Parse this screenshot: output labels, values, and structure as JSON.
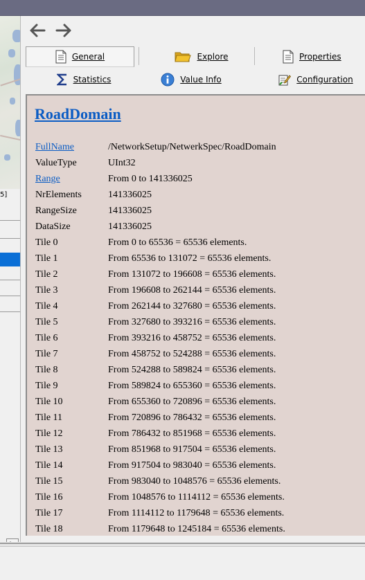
{
  "left_panel": {
    "tag_text": "5]"
  },
  "toolbar": {
    "general": "General",
    "explore": "Explore",
    "properties": "Properties",
    "statistics": "Statistics",
    "value_info": "Value Info",
    "configuration": "Configuration"
  },
  "icons": {
    "back": "arrow-left-icon",
    "forward": "arrow-right-icon",
    "general": "document-icon",
    "explore": "folder-icon",
    "properties": "document-icon",
    "statistics": "sigma-icon",
    "value_info": "info-icon",
    "configuration": "edit-document-icon"
  },
  "colors": {
    "link": "#0b5cc4",
    "content_bg": "#e1d4d0",
    "title_bar": "#6a6b82",
    "info_blue": "#3a7fd4",
    "folder_yellow": "#f2c22e"
  },
  "page": {
    "title": "RoadDomain",
    "rows": [
      {
        "key": "FullName",
        "value": "/NetworkSetup/NetwerkSpec/RoadDomain",
        "link": true
      },
      {
        "key": "ValueType",
        "value": "UInt32",
        "link": false
      },
      {
        "key": "Range",
        "value": "From 0 to 141336025",
        "link": true
      },
      {
        "key": "NrElements",
        "value": "141336025",
        "link": false
      },
      {
        "key": "RangeSize",
        "value": "141336025",
        "link": false
      },
      {
        "key": "DataSize",
        "value": "141336025",
        "link": false
      },
      {
        "key": "Tile 0",
        "value": "From 0 to 65536 = 65536 elements.",
        "link": false
      },
      {
        "key": "Tile 1",
        "value": "From 65536 to 131072 = 65536 elements.",
        "link": false
      },
      {
        "key": "Tile 2",
        "value": "From 131072 to 196608 = 65536 elements.",
        "link": false
      },
      {
        "key": "Tile 3",
        "value": "From 196608 to 262144 = 65536 elements.",
        "link": false
      },
      {
        "key": "Tile 4",
        "value": "From 262144 to 327680 = 65536 elements.",
        "link": false
      },
      {
        "key": "Tile 5",
        "value": "From 327680 to 393216 = 65536 elements.",
        "link": false
      },
      {
        "key": "Tile 6",
        "value": "From 393216 to 458752 = 65536 elements.",
        "link": false
      },
      {
        "key": "Tile 7",
        "value": "From 458752 to 524288 = 65536 elements.",
        "link": false
      },
      {
        "key": "Tile 8",
        "value": "From 524288 to 589824 = 65536 elements.",
        "link": false
      },
      {
        "key": "Tile 9",
        "value": "From 589824 to 655360 = 65536 elements.",
        "link": false
      },
      {
        "key": "Tile 10",
        "value": "From 655360 to 720896 = 65536 elements.",
        "link": false
      },
      {
        "key": "Tile 11",
        "value": "From 720896 to 786432 = 65536 elements.",
        "link": false
      },
      {
        "key": "Tile 12",
        "value": "From 786432 to 851968 = 65536 elements.",
        "link": false
      },
      {
        "key": "Tile 13",
        "value": "From 851968 to 917504 = 65536 elements.",
        "link": false
      },
      {
        "key": "Tile 14",
        "value": "From 917504 to 983040 = 65536 elements.",
        "link": false
      },
      {
        "key": "Tile 15",
        "value": "From 983040 to 1048576 = 65536 elements.",
        "link": false
      },
      {
        "key": "Tile 16",
        "value": "From 1048576 to 1114112 = 65536 elements.",
        "link": false
      },
      {
        "key": "Tile 17",
        "value": "From 1114112 to 1179648 = 65536 elements.",
        "link": false
      },
      {
        "key": "Tile 18",
        "value": "From 1179648 to 1245184 = 65536 elements.",
        "link": false
      }
    ]
  }
}
